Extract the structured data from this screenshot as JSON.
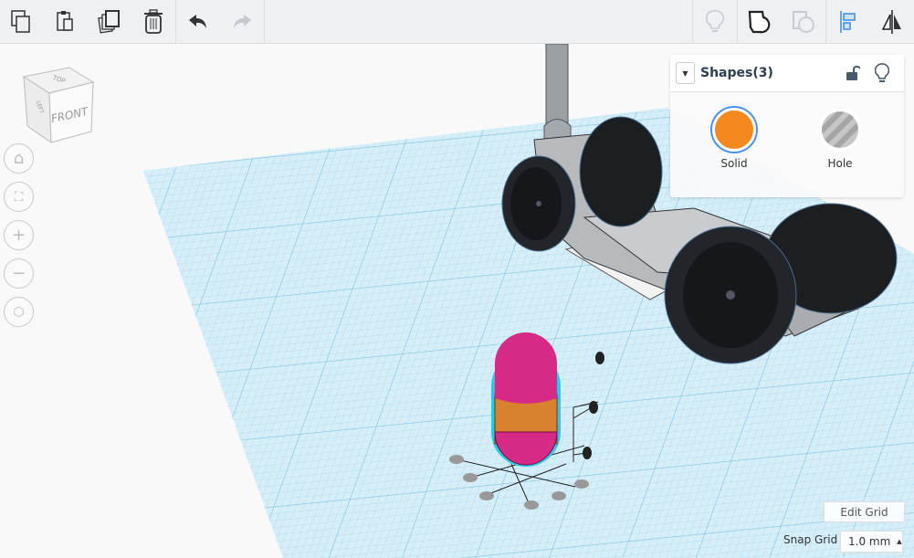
{
  "toolbar": {
    "left": [
      "copy",
      "paste",
      "duplicate",
      "delete",
      "undo",
      "redo"
    ],
    "right": [
      "show-all",
      "group",
      "ungroup",
      "align",
      "mirror"
    ]
  },
  "view_cube": {
    "top": "TOP",
    "front": "FRONT",
    "left": "LEFT"
  },
  "shapes_panel": {
    "title": "Shapes(3)",
    "solid_label": "Solid",
    "hole_label": "Hole",
    "solid_color": "#f5891f"
  },
  "grid": {
    "edit_label": "Edit Grid",
    "snap_label": "Snap Grid",
    "snap_value": "1.0 mm"
  },
  "colors": {
    "accent": "#3b8be0",
    "grid": "#cde9f4",
    "shape_pink": "#d62a86",
    "shape_orange": "#d9822e"
  }
}
